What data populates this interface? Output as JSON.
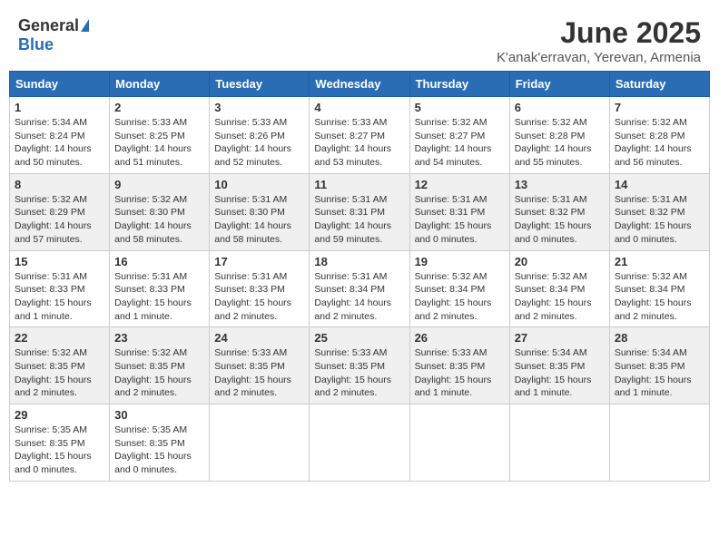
{
  "header": {
    "logo_general": "General",
    "logo_blue": "Blue",
    "month_title": "June 2025",
    "location": "K'anak'erravan, Yerevan, Armenia"
  },
  "calendar": {
    "days_of_week": [
      "Sunday",
      "Monday",
      "Tuesday",
      "Wednesday",
      "Thursday",
      "Friday",
      "Saturday"
    ],
    "weeks": [
      [
        null,
        null,
        null,
        null,
        null,
        null,
        null
      ]
    ],
    "cells": [
      {
        "day": null,
        "info": ""
      },
      {
        "day": null,
        "info": ""
      },
      {
        "day": null,
        "info": ""
      },
      {
        "day": null,
        "info": ""
      },
      {
        "day": null,
        "info": ""
      },
      {
        "day": null,
        "info": ""
      },
      {
        "day": null,
        "info": ""
      }
    ]
  },
  "rows": [
    {
      "cells": [
        {
          "day": "1",
          "sunrise": "Sunrise: 5:34 AM",
          "sunset": "Sunset: 8:24 PM",
          "daylight": "Daylight: 14 hours and 50 minutes."
        },
        {
          "day": "2",
          "sunrise": "Sunrise: 5:33 AM",
          "sunset": "Sunset: 8:25 PM",
          "daylight": "Daylight: 14 hours and 51 minutes."
        },
        {
          "day": "3",
          "sunrise": "Sunrise: 5:33 AM",
          "sunset": "Sunset: 8:26 PM",
          "daylight": "Daylight: 14 hours and 52 minutes."
        },
        {
          "day": "4",
          "sunrise": "Sunrise: 5:33 AM",
          "sunset": "Sunset: 8:27 PM",
          "daylight": "Daylight: 14 hours and 53 minutes."
        },
        {
          "day": "5",
          "sunrise": "Sunrise: 5:32 AM",
          "sunset": "Sunset: 8:27 PM",
          "daylight": "Daylight: 14 hours and 54 minutes."
        },
        {
          "day": "6",
          "sunrise": "Sunrise: 5:32 AM",
          "sunset": "Sunset: 8:28 PM",
          "daylight": "Daylight: 14 hours and 55 minutes."
        },
        {
          "day": "7",
          "sunrise": "Sunrise: 5:32 AM",
          "sunset": "Sunset: 8:28 PM",
          "daylight": "Daylight: 14 hours and 56 minutes."
        }
      ]
    },
    {
      "cells": [
        {
          "day": "8",
          "sunrise": "Sunrise: 5:32 AM",
          "sunset": "Sunset: 8:29 PM",
          "daylight": "Daylight: 14 hours and 57 minutes."
        },
        {
          "day": "9",
          "sunrise": "Sunrise: 5:32 AM",
          "sunset": "Sunset: 8:30 PM",
          "daylight": "Daylight: 14 hours and 58 minutes."
        },
        {
          "day": "10",
          "sunrise": "Sunrise: 5:31 AM",
          "sunset": "Sunset: 8:30 PM",
          "daylight": "Daylight: 14 hours and 58 minutes."
        },
        {
          "day": "11",
          "sunrise": "Sunrise: 5:31 AM",
          "sunset": "Sunset: 8:31 PM",
          "daylight": "Daylight: 14 hours and 59 minutes."
        },
        {
          "day": "12",
          "sunrise": "Sunrise: 5:31 AM",
          "sunset": "Sunset: 8:31 PM",
          "daylight": "Daylight: 15 hours and 0 minutes."
        },
        {
          "day": "13",
          "sunrise": "Sunrise: 5:31 AM",
          "sunset": "Sunset: 8:32 PM",
          "daylight": "Daylight: 15 hours and 0 minutes."
        },
        {
          "day": "14",
          "sunrise": "Sunrise: 5:31 AM",
          "sunset": "Sunset: 8:32 PM",
          "daylight": "Daylight: 15 hours and 0 minutes."
        }
      ]
    },
    {
      "cells": [
        {
          "day": "15",
          "sunrise": "Sunrise: 5:31 AM",
          "sunset": "Sunset: 8:33 PM",
          "daylight": "Daylight: 15 hours and 1 minute."
        },
        {
          "day": "16",
          "sunrise": "Sunrise: 5:31 AM",
          "sunset": "Sunset: 8:33 PM",
          "daylight": "Daylight: 15 hours and 1 minute."
        },
        {
          "day": "17",
          "sunrise": "Sunrise: 5:31 AM",
          "sunset": "Sunset: 8:33 PM",
          "daylight": "Daylight: 15 hours and 2 minutes."
        },
        {
          "day": "18",
          "sunrise": "Sunrise: 5:31 AM",
          "sunset": "Sunset: 8:34 PM",
          "daylight": "Daylight: 14 hours and 2 minutes."
        },
        {
          "day": "19",
          "sunrise": "Sunrise: 5:32 AM",
          "sunset": "Sunset: 8:34 PM",
          "daylight": "Daylight: 15 hours and 2 minutes."
        },
        {
          "day": "20",
          "sunrise": "Sunrise: 5:32 AM",
          "sunset": "Sunset: 8:34 PM",
          "daylight": "Daylight: 15 hours and 2 minutes."
        },
        {
          "day": "21",
          "sunrise": "Sunrise: 5:32 AM",
          "sunset": "Sunset: 8:34 PM",
          "daylight": "Daylight: 15 hours and 2 minutes."
        }
      ]
    },
    {
      "cells": [
        {
          "day": "22",
          "sunrise": "Sunrise: 5:32 AM",
          "sunset": "Sunset: 8:35 PM",
          "daylight": "Daylight: 15 hours and 2 minutes."
        },
        {
          "day": "23",
          "sunrise": "Sunrise: 5:32 AM",
          "sunset": "Sunset: 8:35 PM",
          "daylight": "Daylight: 15 hours and 2 minutes."
        },
        {
          "day": "24",
          "sunrise": "Sunrise: 5:33 AM",
          "sunset": "Sunset: 8:35 PM",
          "daylight": "Daylight: 15 hours and 2 minutes."
        },
        {
          "day": "25",
          "sunrise": "Sunrise: 5:33 AM",
          "sunset": "Sunset: 8:35 PM",
          "daylight": "Daylight: 15 hours and 2 minutes."
        },
        {
          "day": "26",
          "sunrise": "Sunrise: 5:33 AM",
          "sunset": "Sunset: 8:35 PM",
          "daylight": "Daylight: 15 hours and 1 minute."
        },
        {
          "day": "27",
          "sunrise": "Sunrise: 5:34 AM",
          "sunset": "Sunset: 8:35 PM",
          "daylight": "Daylight: 15 hours and 1 minute."
        },
        {
          "day": "28",
          "sunrise": "Sunrise: 5:34 AM",
          "sunset": "Sunset: 8:35 PM",
          "daylight": "Daylight: 15 hours and 1 minute."
        }
      ]
    },
    {
      "cells": [
        {
          "day": "29",
          "sunrise": "Sunrise: 5:35 AM",
          "sunset": "Sunset: 8:35 PM",
          "daylight": "Daylight: 15 hours and 0 minutes."
        },
        {
          "day": "30",
          "sunrise": "Sunrise: 5:35 AM",
          "sunset": "Sunset: 8:35 PM",
          "daylight": "Daylight: 15 hours and 0 minutes."
        },
        null,
        null,
        null,
        null,
        null
      ]
    }
  ]
}
